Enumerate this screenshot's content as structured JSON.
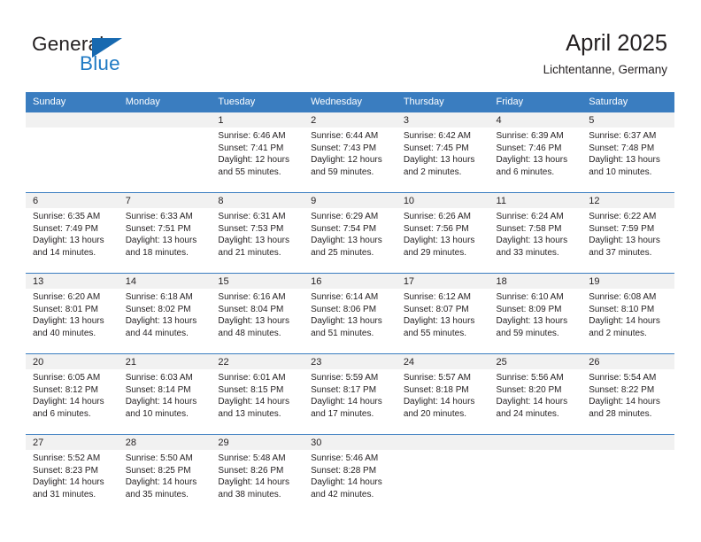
{
  "brand": {
    "name_top": "General",
    "name_bottom": "Blue",
    "accent_color": "#1769b0",
    "text_color": "#231f20",
    "triangle_icon": "triangle-icon"
  },
  "header": {
    "title": "April 2025",
    "location": "Lichtentanne, Germany"
  },
  "calendar": {
    "header_bg": "#3a7dc0",
    "header_text_color": "#ffffff",
    "daynum_band_bg": "#f1f1f1",
    "weekday_headers": [
      "Sunday",
      "Monday",
      "Tuesday",
      "Wednesday",
      "Thursday",
      "Friday",
      "Saturday"
    ],
    "weeks": [
      [
        {
          "day": "",
          "sunrise": "",
          "sunset": "",
          "daylight_line1": "",
          "daylight_line2": ""
        },
        {
          "day": "",
          "sunrise": "",
          "sunset": "",
          "daylight_line1": "",
          "daylight_line2": ""
        },
        {
          "day": "1",
          "sunrise": "Sunrise: 6:46 AM",
          "sunset": "Sunset: 7:41 PM",
          "daylight_line1": "Daylight: 12 hours",
          "daylight_line2": "and 55 minutes."
        },
        {
          "day": "2",
          "sunrise": "Sunrise: 6:44 AM",
          "sunset": "Sunset: 7:43 PM",
          "daylight_line1": "Daylight: 12 hours",
          "daylight_line2": "and 59 minutes."
        },
        {
          "day": "3",
          "sunrise": "Sunrise: 6:42 AM",
          "sunset": "Sunset: 7:45 PM",
          "daylight_line1": "Daylight: 13 hours",
          "daylight_line2": "and 2 minutes."
        },
        {
          "day": "4",
          "sunrise": "Sunrise: 6:39 AM",
          "sunset": "Sunset: 7:46 PM",
          "daylight_line1": "Daylight: 13 hours",
          "daylight_line2": "and 6 minutes."
        },
        {
          "day": "5",
          "sunrise": "Sunrise: 6:37 AM",
          "sunset": "Sunset: 7:48 PM",
          "daylight_line1": "Daylight: 13 hours",
          "daylight_line2": "and 10 minutes."
        }
      ],
      [
        {
          "day": "6",
          "sunrise": "Sunrise: 6:35 AM",
          "sunset": "Sunset: 7:49 PM",
          "daylight_line1": "Daylight: 13 hours",
          "daylight_line2": "and 14 minutes."
        },
        {
          "day": "7",
          "sunrise": "Sunrise: 6:33 AM",
          "sunset": "Sunset: 7:51 PM",
          "daylight_line1": "Daylight: 13 hours",
          "daylight_line2": "and 18 minutes."
        },
        {
          "day": "8",
          "sunrise": "Sunrise: 6:31 AM",
          "sunset": "Sunset: 7:53 PM",
          "daylight_line1": "Daylight: 13 hours",
          "daylight_line2": "and 21 minutes."
        },
        {
          "day": "9",
          "sunrise": "Sunrise: 6:29 AM",
          "sunset": "Sunset: 7:54 PM",
          "daylight_line1": "Daylight: 13 hours",
          "daylight_line2": "and 25 minutes."
        },
        {
          "day": "10",
          "sunrise": "Sunrise: 6:26 AM",
          "sunset": "Sunset: 7:56 PM",
          "daylight_line1": "Daylight: 13 hours",
          "daylight_line2": "and 29 minutes."
        },
        {
          "day": "11",
          "sunrise": "Sunrise: 6:24 AM",
          "sunset": "Sunset: 7:58 PM",
          "daylight_line1": "Daylight: 13 hours",
          "daylight_line2": "and 33 minutes."
        },
        {
          "day": "12",
          "sunrise": "Sunrise: 6:22 AM",
          "sunset": "Sunset: 7:59 PM",
          "daylight_line1": "Daylight: 13 hours",
          "daylight_line2": "and 37 minutes."
        }
      ],
      [
        {
          "day": "13",
          "sunrise": "Sunrise: 6:20 AM",
          "sunset": "Sunset: 8:01 PM",
          "daylight_line1": "Daylight: 13 hours",
          "daylight_line2": "and 40 minutes."
        },
        {
          "day": "14",
          "sunrise": "Sunrise: 6:18 AM",
          "sunset": "Sunset: 8:02 PM",
          "daylight_line1": "Daylight: 13 hours",
          "daylight_line2": "and 44 minutes."
        },
        {
          "day": "15",
          "sunrise": "Sunrise: 6:16 AM",
          "sunset": "Sunset: 8:04 PM",
          "daylight_line1": "Daylight: 13 hours",
          "daylight_line2": "and 48 minutes."
        },
        {
          "day": "16",
          "sunrise": "Sunrise: 6:14 AM",
          "sunset": "Sunset: 8:06 PM",
          "daylight_line1": "Daylight: 13 hours",
          "daylight_line2": "and 51 minutes."
        },
        {
          "day": "17",
          "sunrise": "Sunrise: 6:12 AM",
          "sunset": "Sunset: 8:07 PM",
          "daylight_line1": "Daylight: 13 hours",
          "daylight_line2": "and 55 minutes."
        },
        {
          "day": "18",
          "sunrise": "Sunrise: 6:10 AM",
          "sunset": "Sunset: 8:09 PM",
          "daylight_line1": "Daylight: 13 hours",
          "daylight_line2": "and 59 minutes."
        },
        {
          "day": "19",
          "sunrise": "Sunrise: 6:08 AM",
          "sunset": "Sunset: 8:10 PM",
          "daylight_line1": "Daylight: 14 hours",
          "daylight_line2": "and 2 minutes."
        }
      ],
      [
        {
          "day": "20",
          "sunrise": "Sunrise: 6:05 AM",
          "sunset": "Sunset: 8:12 PM",
          "daylight_line1": "Daylight: 14 hours",
          "daylight_line2": "and 6 minutes."
        },
        {
          "day": "21",
          "sunrise": "Sunrise: 6:03 AM",
          "sunset": "Sunset: 8:14 PM",
          "daylight_line1": "Daylight: 14 hours",
          "daylight_line2": "and 10 minutes."
        },
        {
          "day": "22",
          "sunrise": "Sunrise: 6:01 AM",
          "sunset": "Sunset: 8:15 PM",
          "daylight_line1": "Daylight: 14 hours",
          "daylight_line2": "and 13 minutes."
        },
        {
          "day": "23",
          "sunrise": "Sunrise: 5:59 AM",
          "sunset": "Sunset: 8:17 PM",
          "daylight_line1": "Daylight: 14 hours",
          "daylight_line2": "and 17 minutes."
        },
        {
          "day": "24",
          "sunrise": "Sunrise: 5:57 AM",
          "sunset": "Sunset: 8:18 PM",
          "daylight_line1": "Daylight: 14 hours",
          "daylight_line2": "and 20 minutes."
        },
        {
          "day": "25",
          "sunrise": "Sunrise: 5:56 AM",
          "sunset": "Sunset: 8:20 PM",
          "daylight_line1": "Daylight: 14 hours",
          "daylight_line2": "and 24 minutes."
        },
        {
          "day": "26",
          "sunrise": "Sunrise: 5:54 AM",
          "sunset": "Sunset: 8:22 PM",
          "daylight_line1": "Daylight: 14 hours",
          "daylight_line2": "and 28 minutes."
        }
      ],
      [
        {
          "day": "27",
          "sunrise": "Sunrise: 5:52 AM",
          "sunset": "Sunset: 8:23 PM",
          "daylight_line1": "Daylight: 14 hours",
          "daylight_line2": "and 31 minutes."
        },
        {
          "day": "28",
          "sunrise": "Sunrise: 5:50 AM",
          "sunset": "Sunset: 8:25 PM",
          "daylight_line1": "Daylight: 14 hours",
          "daylight_line2": "and 35 minutes."
        },
        {
          "day": "29",
          "sunrise": "Sunrise: 5:48 AM",
          "sunset": "Sunset: 8:26 PM",
          "daylight_line1": "Daylight: 14 hours",
          "daylight_line2": "and 38 minutes."
        },
        {
          "day": "30",
          "sunrise": "Sunrise: 5:46 AM",
          "sunset": "Sunset: 8:28 PM",
          "daylight_line1": "Daylight: 14 hours",
          "daylight_line2": "and 42 minutes."
        },
        {
          "day": "",
          "sunrise": "",
          "sunset": "",
          "daylight_line1": "",
          "daylight_line2": ""
        },
        {
          "day": "",
          "sunrise": "",
          "sunset": "",
          "daylight_line1": "",
          "daylight_line2": ""
        },
        {
          "day": "",
          "sunrise": "",
          "sunset": "",
          "daylight_line1": "",
          "daylight_line2": ""
        }
      ]
    ]
  }
}
